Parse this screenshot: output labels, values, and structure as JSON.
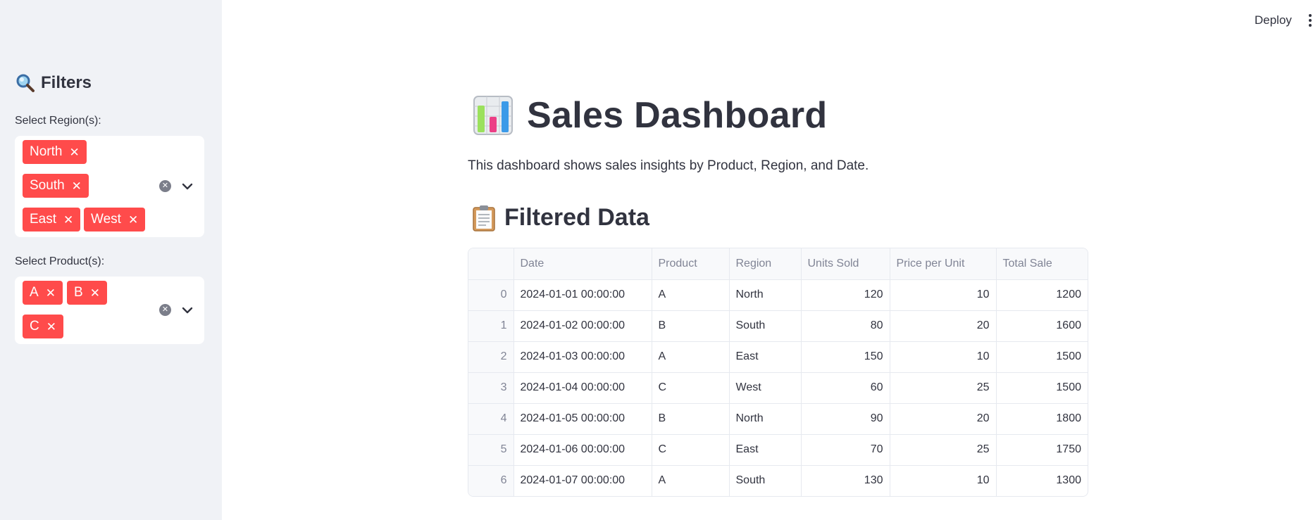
{
  "sidebar": {
    "title": "Filters",
    "title_icon": "magnifier-icon",
    "region": {
      "label": "Select Region(s):",
      "selected": [
        "North",
        "South",
        "East",
        "West"
      ]
    },
    "product": {
      "label": "Select Product(s):",
      "selected": [
        "A",
        "B",
        "C"
      ]
    }
  },
  "header": {
    "deploy_label": "Deploy",
    "menu_icon": "vertical-dots-icon"
  },
  "main": {
    "title": "Sales Dashboard",
    "title_icon": "bar-chart-icon",
    "description": "This dashboard shows sales insights by Product, Region, and Date.",
    "section_title": "Filtered Data",
    "section_icon": "clipboard-icon"
  },
  "table": {
    "columns": [
      "",
      "Date",
      "Product",
      "Region",
      "Units Sold",
      "Price per Unit",
      "Total Sale"
    ],
    "rows": [
      [
        "0",
        "2024-01-01 00:00:00",
        "A",
        "North",
        "120",
        "10",
        "1200"
      ],
      [
        "1",
        "2024-01-02 00:00:00",
        "B",
        "South",
        "80",
        "20",
        "1600"
      ],
      [
        "2",
        "2024-01-03 00:00:00",
        "A",
        "East",
        "150",
        "10",
        "1500"
      ],
      [
        "3",
        "2024-01-04 00:00:00",
        "C",
        "West",
        "60",
        "25",
        "1500"
      ],
      [
        "4",
        "2024-01-05 00:00:00",
        "B",
        "North",
        "90",
        "20",
        "1800"
      ],
      [
        "5",
        "2024-01-06 00:00:00",
        "C",
        "East",
        "70",
        "25",
        "1750"
      ],
      [
        "6",
        "2024-01-07 00:00:00",
        "A",
        "South",
        "130",
        "10",
        "1300"
      ]
    ]
  },
  "colors": {
    "chip": "#ff4b4b",
    "sidebar_bg": "#f0f2f6",
    "text": "#31333f"
  }
}
